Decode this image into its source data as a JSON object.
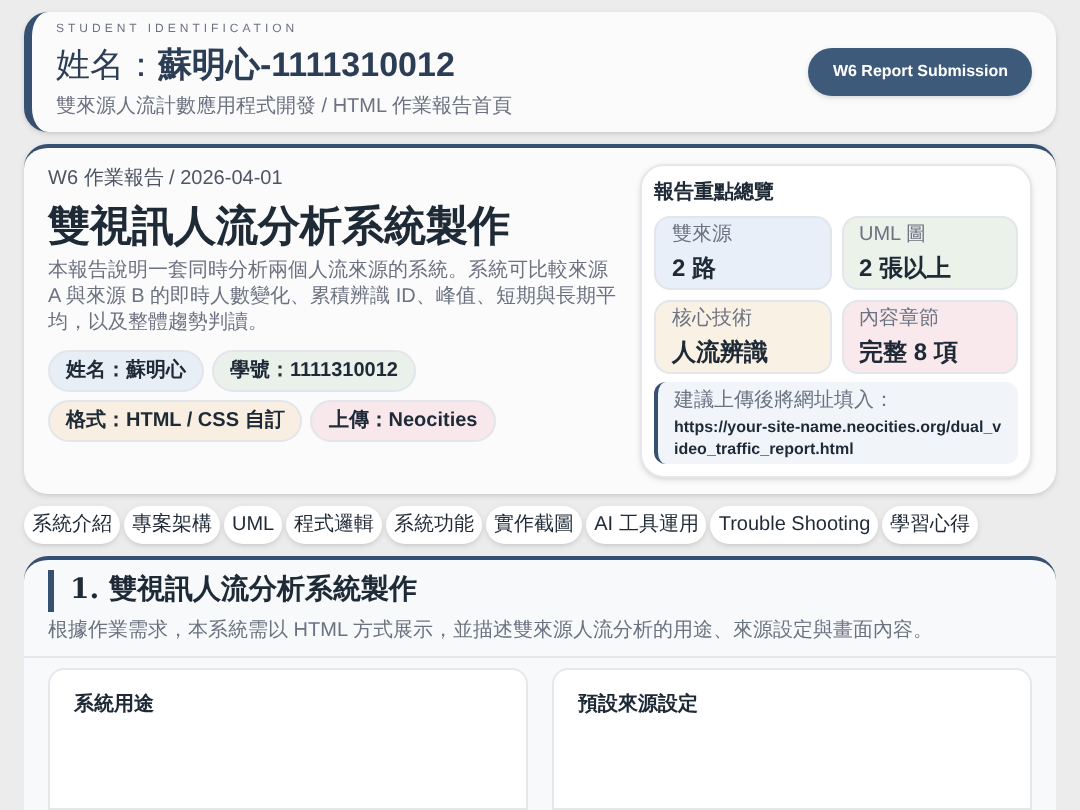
{
  "header": {
    "eyebrow": "STUDENT IDENTIFICATION",
    "name_label": "姓名：",
    "name_value": "蘇明心-1111310012",
    "subtitle": "雙來源人流計數應用程式開發 / HTML 作業報告首頁",
    "button": "W6 Report Submission"
  },
  "hero": {
    "meta": "W6 作業報告 / 2026-04-01",
    "title": "雙視訊人流分析系統製作",
    "description": "本報告說明一套同時分析兩個人流來源的系統。系統可比較來源 A 與來源 B 的即時人數變化、累積辨識 ID、峰值、短期與長期平均，以及整體趨勢判讀。",
    "tags": [
      {
        "text": "姓名：蘇明心",
        "color": "#e8eef6"
      },
      {
        "text": "學號：1111310012",
        "color": "#e9f1ea"
      },
      {
        "text": "格式：HTML / CSS 自訂",
        "color": "#f8efe2"
      },
      {
        "text": "上傳：Neocities",
        "color": "#f8e8ec"
      }
    ]
  },
  "overview": {
    "title": "報告重點總覽",
    "stats": [
      {
        "label": "雙來源",
        "value": "2 路",
        "color": "#e8eff8"
      },
      {
        "label": "UML 圖",
        "value": "2 張以上",
        "color": "#eaf2ea"
      },
      {
        "label": "核心技術",
        "value": "人流辨識",
        "color": "#f9f1e4"
      },
      {
        "label": "內容章節",
        "value": "完整 8 項",
        "color": "#f9e8ec"
      }
    ],
    "note_label": "建議上傳後將網址填入：",
    "note_url": "https://your-site-name.neocities.org/dual_video_traffic_report.html"
  },
  "nav": [
    {
      "label": "系統介紹"
    },
    {
      "label": "專案架構"
    },
    {
      "label": "UML"
    },
    {
      "label": "程式邏輯"
    },
    {
      "label": "系統功能"
    },
    {
      "label": "實作截圖"
    },
    {
      "label": "AI 工具運用"
    },
    {
      "label": "Trouble Shooting"
    },
    {
      "label": "學習心得"
    }
  ],
  "section": {
    "title": "1. 雙視訊人流分析系統製作",
    "description": "根據作業需求，本系統需以 HTML 方式展示，並描述雙來源人流分析的用途、來源設定與畫面內容。",
    "cards": [
      {
        "title": "系統用途"
      },
      {
        "title": "預設來源設定"
      }
    ]
  }
}
